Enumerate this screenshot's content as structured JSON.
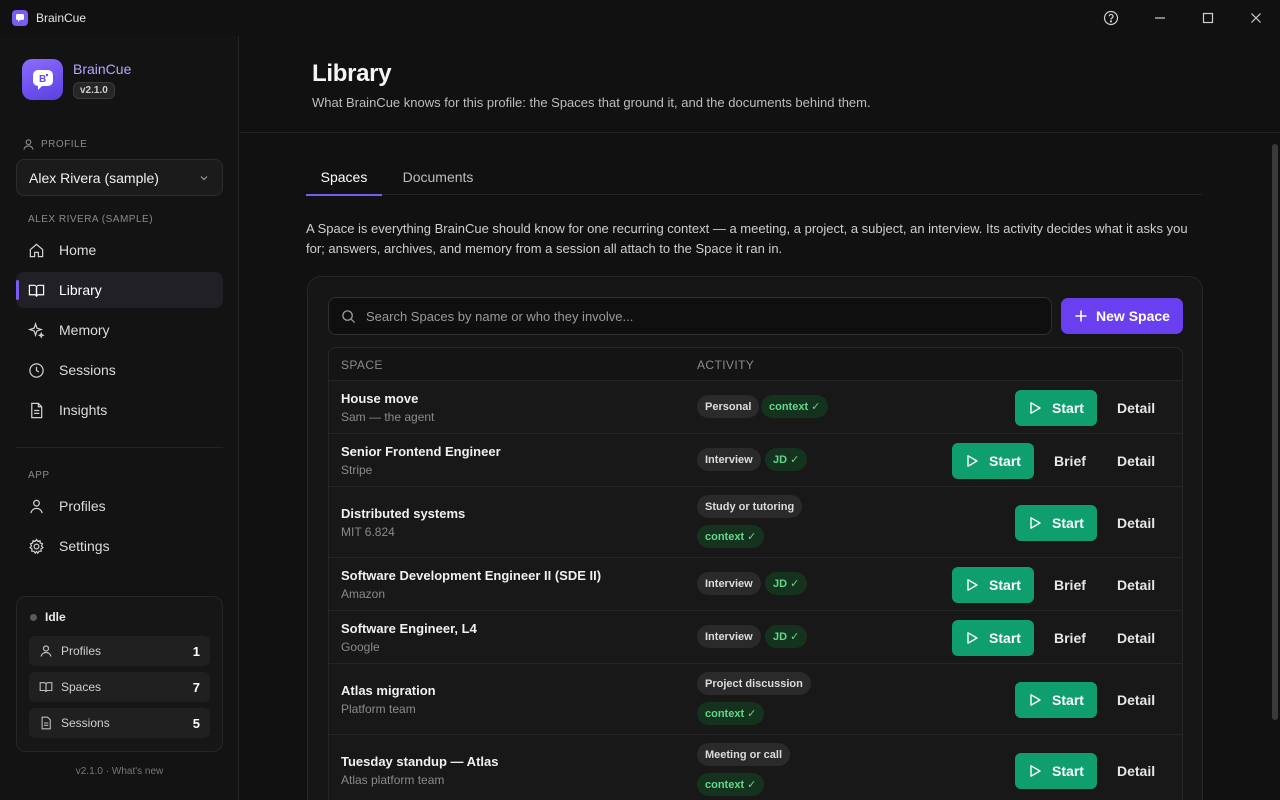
{
  "window": {
    "title": "BrainCue",
    "controls": [
      "help-icon",
      "minimize-icon",
      "maximize-icon",
      "close-icon"
    ]
  },
  "sidebar": {
    "brand_name": "BrainCue",
    "version": "v2.1.0",
    "profile_label": "PROFILE",
    "profile_selected": "Alex Rivera (sample)",
    "profile_section": "ALEX RIVERA (SAMPLE)",
    "nav": [
      {
        "label": "Home",
        "icon": "home-icon"
      },
      {
        "label": "Library",
        "icon": "book-icon",
        "active": true
      },
      {
        "label": "Memory",
        "icon": "sparkle-icon"
      },
      {
        "label": "Sessions",
        "icon": "clock-icon"
      },
      {
        "label": "Insights",
        "icon": "document-icon"
      }
    ],
    "app_section": "APP",
    "app_nav": [
      {
        "label": "Profiles",
        "icon": "user-icon"
      },
      {
        "label": "Settings",
        "icon": "gear-icon"
      }
    ],
    "status": {
      "state": "Idle",
      "stats": [
        {
          "label": "Profiles",
          "value": "1",
          "icon": "user-icon"
        },
        {
          "label": "Spaces",
          "value": "7",
          "icon": "book-icon"
        },
        {
          "label": "Sessions",
          "value": "5",
          "icon": "document-icon"
        }
      ]
    },
    "footer": "v2.1.0 · What's new"
  },
  "main": {
    "title": "Library",
    "subtitle": "What BrainCue knows for this profile: the Spaces that ground it, and the documents behind them.",
    "tabs": [
      {
        "label": "Spaces",
        "active": true
      },
      {
        "label": "Documents"
      }
    ],
    "intro": "A Space is everything BrainCue should know for one recurring context — a meeting, a project, a subject, an interview. Its activity decides what it asks you for; answers, archives, and memory from a session all attach to the Space it ran in.",
    "search_placeholder": "Search Spaces by name or who they involve...",
    "new_space_label": "New Space",
    "columns": {
      "space": "SPACE",
      "activity": "ACTIVITY"
    },
    "actions": {
      "start": "Start",
      "brief": "Brief",
      "detail": "Detail"
    },
    "spaces": [
      {
        "name": "House move",
        "sub": "Sam — the agent",
        "category": "Personal",
        "status": "context ✓",
        "brief": false
      },
      {
        "name": "Senior Frontend Engineer",
        "sub": "Stripe",
        "category": "Interview",
        "status": "JD ✓",
        "brief": true
      },
      {
        "name": "Distributed systems",
        "sub": "MIT 6.824",
        "category": "Study or tutoring",
        "status": "context ✓",
        "brief": false
      },
      {
        "name": "Software Development Engineer II (SDE II)",
        "sub": "Amazon",
        "category": "Interview",
        "status": "JD ✓",
        "brief": true
      },
      {
        "name": "Software Engineer, L4",
        "sub": "Google",
        "category": "Interview",
        "status": "JD ✓",
        "brief": true
      },
      {
        "name": "Atlas migration",
        "sub": "Platform team",
        "category": "Project discussion",
        "status": "context ✓",
        "brief": false
      },
      {
        "name": "Tuesday standup — Atlas",
        "sub": "Atlas platform team",
        "category": "Meeting or call",
        "status": "context ✓",
        "brief": false
      }
    ]
  },
  "colors": {
    "accent": "#7b5cf0",
    "primary_button": "#6a3ff0",
    "start_button": "#0f9e6e",
    "ok_badge_text": "#5fd88a"
  }
}
